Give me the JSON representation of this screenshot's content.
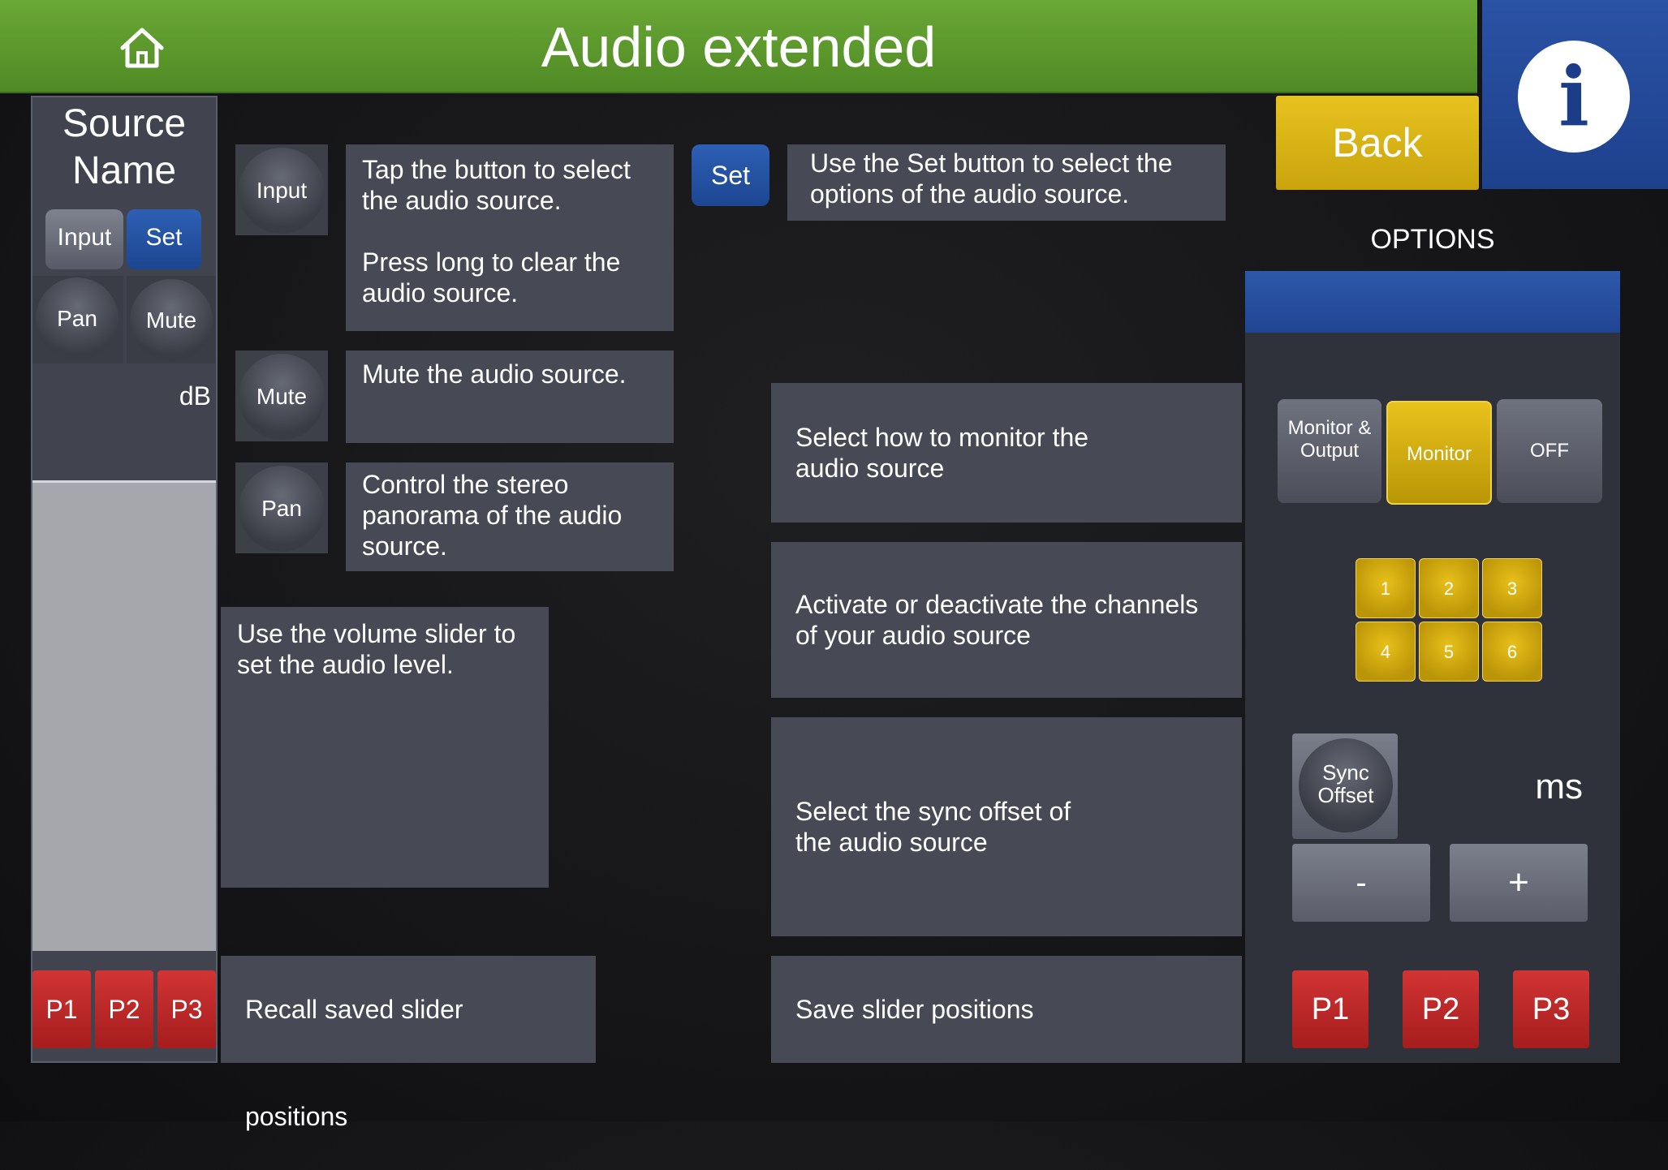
{
  "header": {
    "title": "Audio extended",
    "back_label": "Back",
    "info_glyph": "i",
    "accent_green": "#5a9a2c",
    "accent_blue": "#1e418c"
  },
  "strip": {
    "source_name": "Source Name",
    "input_label": "Input",
    "set_label": "Set",
    "pan_label": "Pan",
    "mute_label": "Mute",
    "db_label": "dB",
    "presets": [
      "P1",
      "P2",
      "P3"
    ]
  },
  "help": {
    "input_demo": "Input",
    "input_text_1": "Tap the button to select the audio source.",
    "input_text_2": "Press long to clear the audio source.",
    "mute_demo": "Mute",
    "mute_text": "Mute the audio source.",
    "pan_demo": "Pan",
    "pan_text": "Control the stereo panorama of the audio source.",
    "set_demo": "Set",
    "set_text": "Use the Set button to select the options of the audio source.",
    "volume_text": "Use the volume slider to set the audio level.",
    "recall_text": "Recall saved slider positions",
    "monitor_text": "Select how to monitor the audio source",
    "channels_text": "Activate or deactivate the channels of your audio source",
    "sync_text": "Select the sync offset of the audio source",
    "save_text": "Save slider positions"
  },
  "options": {
    "label": "OPTIONS",
    "monitor_output_label": "Monitor & Output",
    "monitor_label": "Monitor",
    "off_label": "OFF",
    "monitor_selected": "Monitor",
    "channels": [
      "1",
      "2",
      "3",
      "4",
      "5",
      "6"
    ],
    "sync_offset_label": "Sync Offset",
    "ms_label": "ms",
    "minus_label": "-",
    "plus_label": "+",
    "presets": [
      "P1",
      "P2",
      "P3"
    ]
  }
}
